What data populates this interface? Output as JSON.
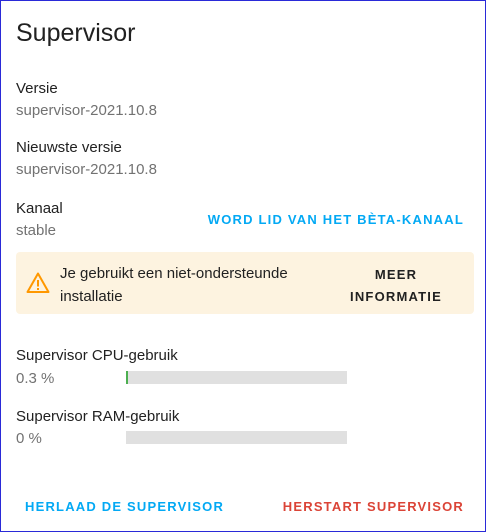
{
  "card": {
    "title": "Supervisor",
    "version": {
      "label": "Versie",
      "value": "supervisor-2021.10.8"
    },
    "latest_version": {
      "label": "Nieuwste versie",
      "value": "supervisor-2021.10.8"
    },
    "channel": {
      "label": "Kanaal",
      "value": "stable",
      "action_label": "WORD LID VAN HET BÈTA-KANAAL"
    },
    "warning": {
      "icon": "alert-triangle-icon",
      "color": "#ff9800",
      "background": "#fdf3e0",
      "text": "Je gebruikt een niet-ondersteunde installatie",
      "action_line1": "MEER",
      "action_line2": "INFORMATIE"
    },
    "cpu": {
      "label": "Supervisor CPU-gebruik",
      "value_text": "0.3 %",
      "percent": 0.3
    },
    "ram": {
      "label": "Supervisor RAM-gebruik",
      "value_text": "0 %",
      "percent": 0
    },
    "actions": {
      "reload_label": "HERLAAD DE SUPERVISOR",
      "restart_label": "HERSTART SUPERVISOR"
    }
  },
  "colors": {
    "primary": "#03a9f4",
    "danger": "#db4437",
    "bar_fill": "#4caf50",
    "bar_track": "#e0e0e0"
  }
}
